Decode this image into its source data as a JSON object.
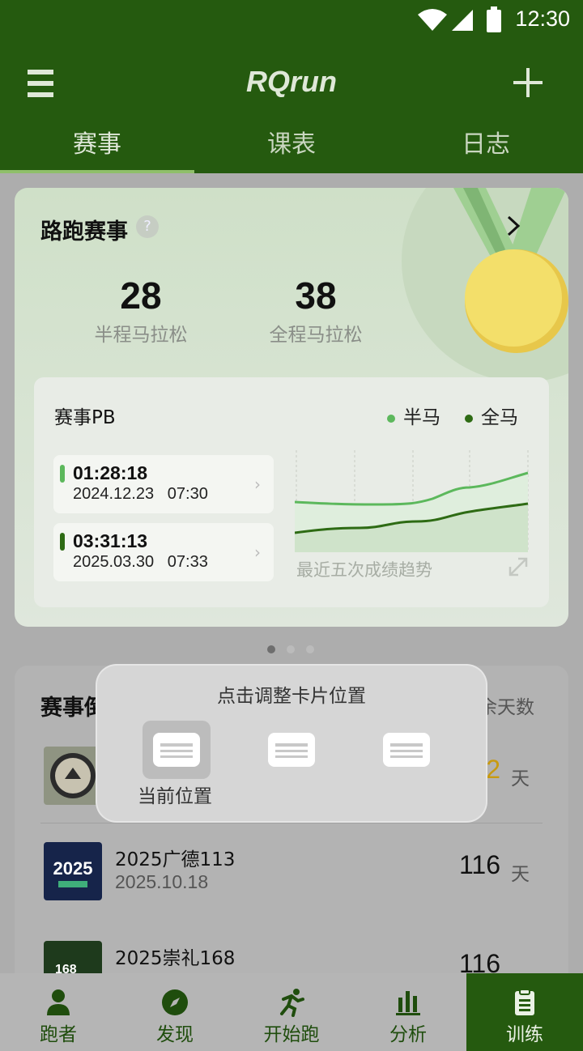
{
  "status_bar": {
    "time": "12:30"
  },
  "app_bar": {
    "title": "RQrun"
  },
  "tabs": [
    {
      "label": "赛事",
      "active": true
    },
    {
      "label": "课表",
      "active": false
    },
    {
      "label": "日志",
      "active": false
    }
  ],
  "race_card": {
    "title": "路跑赛事",
    "help_glyph": "?",
    "stats": [
      {
        "value": "28",
        "label": "半程马拉松"
      },
      {
        "value": "38",
        "label": "全程马拉松"
      }
    ],
    "pb": {
      "title": "赛事PB",
      "legend": [
        {
          "label": "半马",
          "color": "#5cb85c"
        },
        {
          "label": "全马",
          "color": "#2e6b14"
        }
      ],
      "records": [
        {
          "time": "01:28:18",
          "date": "2024.12.23   07:30",
          "color": "#5cb85c"
        },
        {
          "time": "03:31:13",
          "date": "2025.03.30   07:33",
          "color": "#2e6b14"
        }
      ],
      "trend_label": "最近五次成绩趋势"
    }
  },
  "list_card": {
    "title": "赛事倒",
    "column_label": "余天数",
    "items": [
      {
        "name": "",
        "date": "",
        "days": "2",
        "unit": "天",
        "days_color": "#c89a10",
        "thumb_text": "WESTERN STATES"
      },
      {
        "name": "2025广德113",
        "date": "2025.10.18",
        "days": "116",
        "unit": "天",
        "days_color": "#111111",
        "thumb_text": "2025"
      },
      {
        "name": "2025崇礼168",
        "date": "",
        "days": "116",
        "unit": "",
        "days_color": "#111111",
        "thumb_text": "168"
      }
    ]
  },
  "popup": {
    "title": "点击调整卡片位置",
    "current_label": "当前位置"
  },
  "bottom_nav": [
    {
      "label": "跑者",
      "icon": "person-icon",
      "active": false
    },
    {
      "label": "发现",
      "icon": "compass-icon",
      "active": false
    },
    {
      "label": "开始跑",
      "icon": "runner-icon",
      "active": false
    },
    {
      "label": "分析",
      "icon": "bar-chart-icon",
      "active": false
    },
    {
      "label": "训练",
      "icon": "clipboard-icon",
      "active": true
    }
  ]
}
